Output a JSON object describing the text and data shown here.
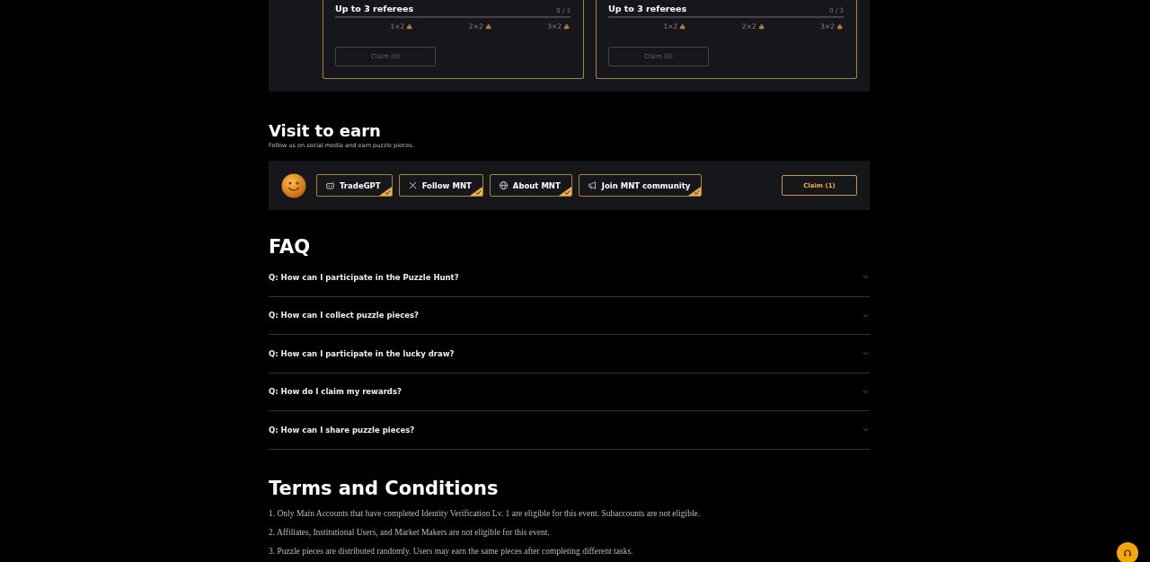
{
  "referral_cards": [
    {
      "title": "Up to 3 referees",
      "count": "0 / 3",
      "level": 0,
      "milestones": [
        {
          "label": "1×2"
        },
        {
          "label": "2×2"
        },
        {
          "label": "3×2"
        }
      ],
      "claim_button": {
        "label": "Claim (0)",
        "disabled": true
      }
    },
    {
      "title": "Up to 3 referees",
      "count": "0 / 3",
      "level": 0,
      "milestones": [
        {
          "label": "1×2"
        },
        {
          "label": "2×2"
        },
        {
          "label": "3×2"
        }
      ],
      "claim_button": {
        "label": "Claim (0)",
        "disabled": true
      }
    }
  ],
  "visit_to_earn": {
    "title": "Visit to earn",
    "subtitle": "Follow us on social media and earn puzzle pieces.",
    "tasks": [
      {
        "kind": "robot",
        "label": "TradeGPT",
        "completed": true
      },
      {
        "kind": "x",
        "label": "Follow MNT",
        "completed": true
      },
      {
        "kind": "globe",
        "label": "About MNT",
        "completed": true
      },
      {
        "kind": "megaphone",
        "label": "Join MNT community",
        "completed": true
      }
    ],
    "claim_button": {
      "label": "Claim (1)",
      "disabled": false
    }
  },
  "faq": {
    "title": "FAQ",
    "items": [
      {
        "question": "Q: How can I participate in the Puzzle Hunt?",
        "expanded": false
      },
      {
        "question": "Q: How can I collect puzzle pieces?",
        "expanded": false
      },
      {
        "question": "Q: How can I participate in the lucky draw?",
        "expanded": false
      },
      {
        "question": "Q: How do I claim my rewards?",
        "expanded": false
      },
      {
        "question": "Q: How can I share puzzle pieces?",
        "expanded": false
      }
    ]
  },
  "terms": {
    "title": "Terms and Conditions",
    "items": [
      "1. Only Main Accounts that have completed Identity Verification Lv. 1 are eligible for this event. Subaccounts are not eligible.",
      "2. Affiliates, Institutional Users, and Market Makers are not eligible for this event.",
      "3. Puzzle pieces are distributed randomly. Users may earn the same pieces after completing different tasks."
    ]
  }
}
